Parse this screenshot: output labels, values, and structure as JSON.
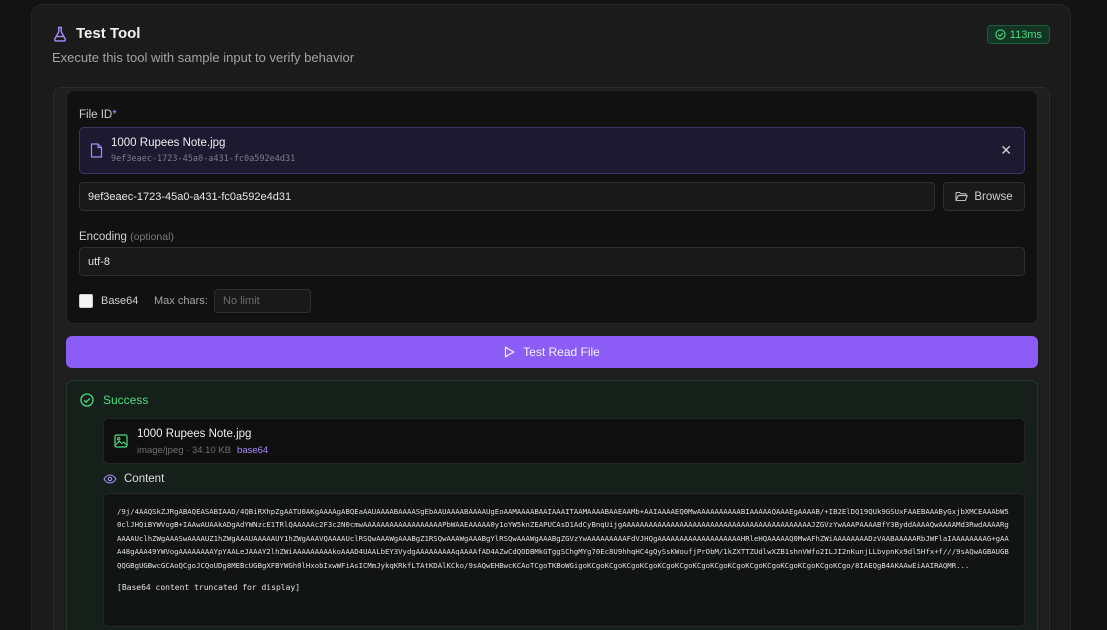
{
  "header": {
    "title": "Test Tool",
    "subtitle": "Execute this tool with sample input to verify behavior",
    "timing": "113ms"
  },
  "form": {
    "file_id_label": "File ID",
    "required_mark": "*",
    "selected_file": {
      "name": "1000 Rupees Note.jpg",
      "id": "9ef3eaec-1723-45a0-a431-fc0a592e4d31"
    },
    "file_id_value": "9ef3eaec-1723-45a0-a431-fc0a592e4d31",
    "browse_label": "Browse",
    "encoding_label": "Encoding",
    "encoding_optional": "(optional)",
    "encoding_value": "utf-8",
    "base64_label": "Base64",
    "max_chars_label": "Max chars:",
    "max_chars_placeholder": "No limit"
  },
  "run_button": "Test Read File",
  "result": {
    "status": "Success",
    "file": {
      "name": "1000 Rupees Note.jpg",
      "mime": "image/jpeg",
      "size": "34.10 KB",
      "encoding": "base64"
    },
    "content_label": "Content",
    "content_text": "/9j/4AAQSkZJRgABAQEASABIAAD/4QBiRXhpZgAATU0AKgAAAAgABQEaAAUAAAABAAAASgEbAAUAAAABAAAAUgEoAAMAAAABAAIAAAITAAMAAAABAAEAAMb+AAIAAAAEQ0MwAAAAAAAAAABIAAAAAQAAAEgAAAAB/+IB2ElDQ19QUk9GSUxFAAEBAAAByGxjbXMCEAAAbW50clJHQiBYWVogB+IAAwAUAAkADgAdYWNzcE1TRlQAAAAAc2F3c2N0cmwAAAAAAAAAAAAAAAAAAPbWAAEAAAAA0y1oYW5knZEAPUCAsD1AdCyBnqUijgAAAAAAAAAAAAAAAAAAAAAAAAAAAAAAAAAAAAAAAAAAAJZGVzYwAAAPAAAABfY3ByddAAAAQwAAAAMd3RwdAAAARgAAAAUclhZWgAAASwAAAAUZ1hZWgAAAUAAAAAUY1hZWgAAAVQAAAAUclRSQwAAAWgAAABgZ1RSQwAAAWgAAABgYlRSQwAAAWgAAABgZGVzYwAAAAAAAAAFdVJHQgAAAAAAAAAAAAAAAAAAAHRleHQAAAAAQ0MwAFhZWiAAAAAAAADzVAABAAAAARbJWFlaIAAAAAAAAG+gAAA48gAAA49YWVogAAAAAAAAYpYAALeJAAAY2lhZWiAAAAAAAAAkoAAAD4UAALbEY3VydgAAAAAAAAAqAAAAfAD4AZwCdQODBMkGTggSChgMYg70Ec8U9hhqHC4gQySsKWoufjPrObM/1kZXTTZUdlwXZB1shnVWfo2ILJI2nKunjLLbvpnKx9dl5Hfx+f///9sAQwAGBAUGBQQGBgUGBwcGCAoQCgoJCQoUDg8MEBcUGBgXFBYWGh0lHxobIxwWFiAsICMmJykqKRkfLTAtKDAlKCko/9sAQwEHBwcKCAoTCgoTKBoWGigoKCgoKCgoKCgoKCgoKCgoKCgoKCgoKCgoKCgoKCgoKCgoKCgoKCgoKCgoKCgo/8IAEQgB4AKAAwEiAAIRAQMR...",
    "truncated_note": "[Base64 content truncated for display]"
  }
}
